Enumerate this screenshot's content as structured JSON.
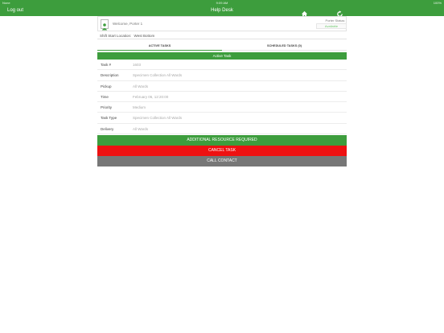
{
  "status_bar": {
    "carrier": "None",
    "time": "9:09 AM",
    "battery": "100%"
  },
  "nav": {
    "logout_label": "Log out",
    "title": "Help Desk"
  },
  "welcome": {
    "text": "Welcome, Porter 1",
    "porter_status_label": "Porter Status:",
    "porter_status_value": "Available"
  },
  "shift": {
    "label": "Shift Start Location:",
    "value": "West Bottom"
  },
  "tabs": [
    {
      "label": "ACTIVE TASKS",
      "active": true
    },
    {
      "label": "SCHEDULED TASKS (0)",
      "active": false
    }
  ],
  "active_task": {
    "header": "Active Task",
    "fields": [
      {
        "label": "Task #",
        "value": "1603"
      },
      {
        "label": "Description",
        "value": "Specimen Collection All Wards"
      },
      {
        "label": "Pickup",
        "value": "All Wards"
      },
      {
        "label": "Time",
        "value": "February 06, 12:20:00"
      },
      {
        "label": "Priority",
        "value": "Medium"
      },
      {
        "label": "Task Type",
        "value": "Specimen Collection All Wards"
      },
      {
        "label": "Delivery",
        "value": "All Wards"
      }
    ]
  },
  "actions": {
    "additional_label": "ADDITIONAL RESOURCE REQUIRED",
    "cancel_label": "CANCEL TASK",
    "call_label": "CALL CONTACT"
  },
  "colors": {
    "brand_green": "#3d9d3d",
    "cancel_red": "#ee1111",
    "call_gray": "#777777"
  },
  "icons": {
    "home": "home-icon",
    "refresh": "refresh-icon",
    "avatar": "person-icon"
  }
}
